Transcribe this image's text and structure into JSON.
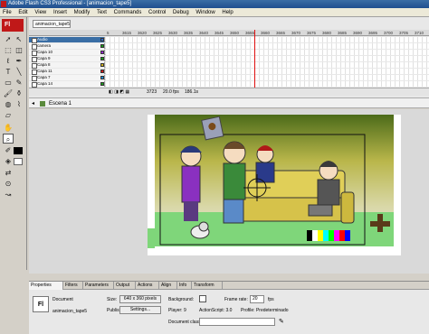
{
  "window": {
    "title": "Adobe Flash CS3 Professional - [animacion_tape5]"
  },
  "menu": [
    "File",
    "Edit",
    "View",
    "Insert",
    "Modify",
    "Text",
    "Commands",
    "Control",
    "Debug",
    "Window",
    "Help"
  ],
  "toolbox": {
    "logo": "Fl"
  },
  "document_tab": "animacion_tape5",
  "timeline": {
    "ruler": [
      "5",
      "3615",
      "3620",
      "3625",
      "3630",
      "3635",
      "3640",
      "3645",
      "3650",
      "3655",
      "3660",
      "3665",
      "3670",
      "3675",
      "3680",
      "3685",
      "3690",
      "3695",
      "3700",
      "3705",
      "3710"
    ],
    "layers": [
      {
        "name": "Audio",
        "color": "#2a6cd6"
      },
      {
        "name": "camera",
        "color": "#1aa01a"
      },
      {
        "name": "Capa 10",
        "color": "#9a2ad6"
      },
      {
        "name": "Capa 9",
        "color": "#1aa01a"
      },
      {
        "name": "Capa 8",
        "color": "#d6b41a"
      },
      {
        "name": "Capa 11",
        "color": "#d61a1a"
      },
      {
        "name": "Capa 7",
        "color": "#1a8ad6"
      },
      {
        "name": "Capa 14",
        "color": "#1aa01a"
      }
    ],
    "status": {
      "frame": "3723",
      "fps": "20.0 fps",
      "time": "186.1s"
    }
  },
  "scene": {
    "label": "Escena 1"
  },
  "properties": {
    "tabs": [
      "Properties",
      "Filters",
      "Parameters",
      "Output",
      "Actions",
      "Align",
      "Info",
      "Transform"
    ],
    "doc_type": "Document",
    "doc_name": "animacion_tape5",
    "size_label": "Size:",
    "size_value": "640 x 360 pixels",
    "background_label": "Background:",
    "frame_rate_label": "Frame rate:",
    "frame_rate_value": "20",
    "fps_unit": "fps",
    "publish_label": "Publish:",
    "settings_button": "Settings...",
    "player_label": "Player: 9",
    "actionscript_label": "ActionScript: 3.0",
    "profile_label": "Profile: Predeterminado",
    "doc_class_label": "Document class:"
  },
  "colors": {
    "accent": "#c01818",
    "title_blue": "#1f4f8f"
  }
}
